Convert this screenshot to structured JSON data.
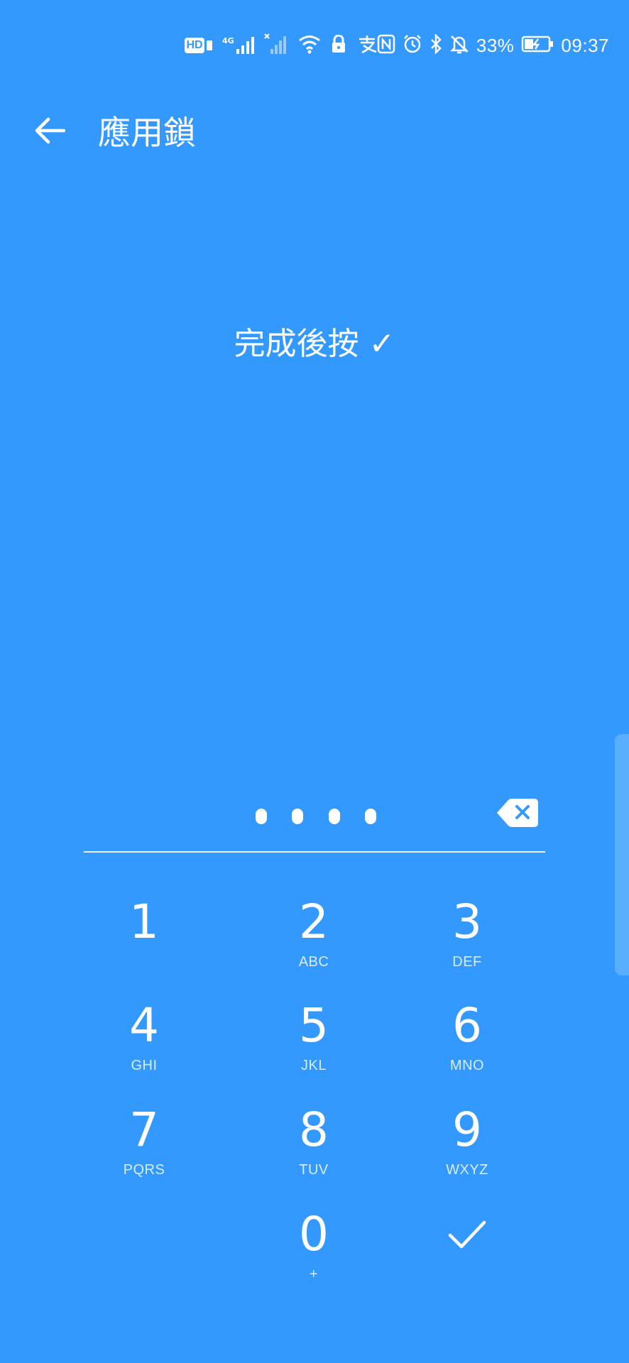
{
  "status_bar": {
    "hd_label": "HD",
    "signal_label": "4G",
    "battery_percent": "33%",
    "time": "09:37"
  },
  "header": {
    "title": "應用鎖"
  },
  "prompt": "完成後按 ✓",
  "pin": {
    "digits_entered": 4
  },
  "keypad": [
    {
      "num": "1",
      "letters": ""
    },
    {
      "num": "2",
      "letters": "ABC"
    },
    {
      "num": "3",
      "letters": "DEF"
    },
    {
      "num": "4",
      "letters": "GHI"
    },
    {
      "num": "5",
      "letters": "JKL"
    },
    {
      "num": "6",
      "letters": "MNO"
    },
    {
      "num": "7",
      "letters": "PQRS"
    },
    {
      "num": "8",
      "letters": "TUV"
    },
    {
      "num": "9",
      "letters": "WXYZ"
    },
    {
      "num": "0",
      "letters": "+"
    }
  ],
  "colors": {
    "background": "#3399ff",
    "foreground": "#ffffff"
  }
}
